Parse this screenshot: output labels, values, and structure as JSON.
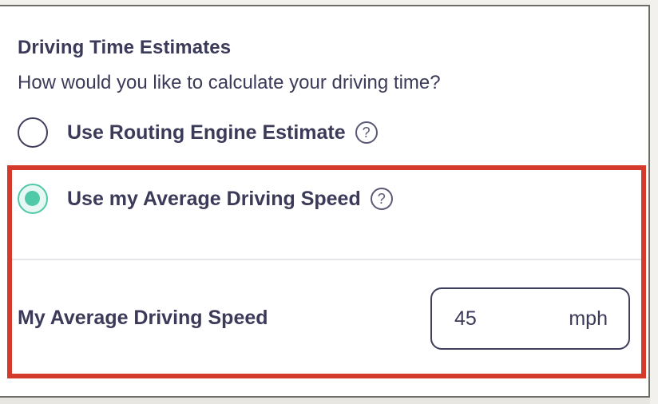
{
  "section": {
    "title": "Driving Time Estimates",
    "question": "How would you like to calculate your driving time?"
  },
  "options": [
    {
      "label": "Use Routing Engine Estimate",
      "selected": false,
      "help_icon": "question-circle-icon"
    },
    {
      "label": "Use my Average Driving Speed",
      "selected": true,
      "help_icon": "question-circle-icon"
    }
  ],
  "help_glyph": "?",
  "average_speed": {
    "label": "My Average Driving Speed",
    "value": "45",
    "unit": "mph"
  },
  "colors": {
    "text": "#3b3a58",
    "accent": "#4fc9a7",
    "highlight": "#d43a2b"
  }
}
